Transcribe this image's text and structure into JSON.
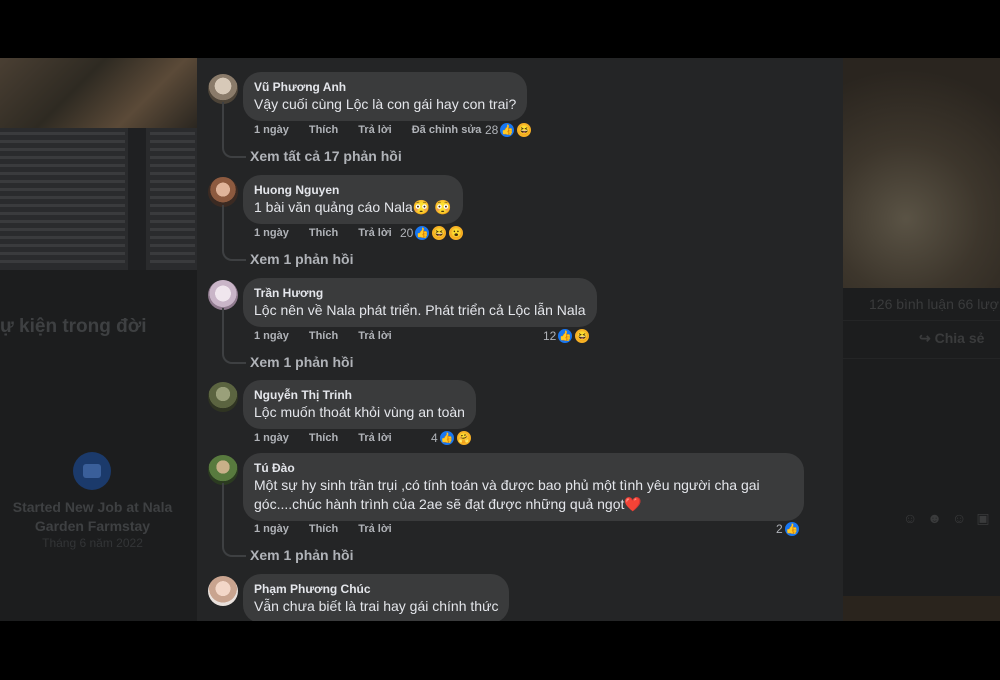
{
  "background_left": {
    "life_event_title": "ự kiện trong đời",
    "job_title": "Started New Job at Nala Garden Farmstay",
    "job_date": "Tháng 6 năm 2022"
  },
  "background_right": {
    "stats": "126 bình luận   66 lượ",
    "share_label": "Chia sẻ"
  },
  "comments": [
    {
      "author": "Vũ Phương Anh",
      "text": "Vậy cuối cùng Lộc là con gái hay con trai?",
      "time": "1 ngày",
      "like": "Thích",
      "reply": "Trả lời",
      "edited": "Đã chỉnh sửa",
      "reaction_count": "28",
      "replies": "Xem tất cả 17 phản hồi"
    },
    {
      "author": "Huong Nguyen",
      "text": "1 bài văn quảng cáo Nala😳 😳",
      "time": "1 ngày",
      "like": "Thích",
      "reply": "Trả lời",
      "reaction_count": "20",
      "replies": "Xem 1 phản hồi"
    },
    {
      "author": "Trần Hương",
      "text": "Lộc nên về Nala phát triển. Phát triển cả Lộc lẫn Nala",
      "time": "1 ngày",
      "like": "Thích",
      "reply": "Trả lời",
      "reaction_count": "12",
      "replies": "Xem 1 phản hồi"
    },
    {
      "author": "Nguyễn Thị Trinh",
      "text": "Lộc muốn thoát khỏi vùng an toàn",
      "time": "1 ngày",
      "like": "Thích",
      "reply": "Trả lời",
      "reaction_count": "4"
    },
    {
      "author": "Tú Đào",
      "text": "Một sự hy sinh trần trụi ,có tính toán và được bao phủ một tình yêu người cha gai góc....chúc hành trình của 2ae sẽ đạt được những quả ngọt❤️",
      "time": "1 ngày",
      "like": "Thích",
      "reply": "Trả lời",
      "reaction_count": "2",
      "replies": "Xem 1 phản hồi"
    },
    {
      "author": "Phạm Phương Chúc",
      "text": "Vẫn chưa biết là trai hay gái chính thức"
    }
  ],
  "colors": {
    "dialog_bg": "#242526",
    "bubble_bg": "#3a3b3c",
    "text_primary": "#e4e6eb",
    "text_secondary": "#b0b3b8",
    "like_blue": "#1877f2"
  }
}
